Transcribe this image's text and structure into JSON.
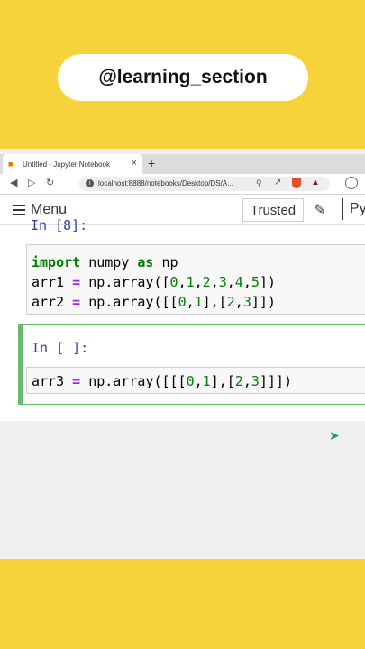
{
  "overlay": {
    "channel_handle": "@learning_section"
  },
  "browser": {
    "tab_title": "Untitled - Jupyter Notebook",
    "new_tab_label": "+",
    "url": "localhost:8888/notebooks/Desktop/DS/A..."
  },
  "notebook": {
    "menu_label": "Menu",
    "trusted_label": "Trusted",
    "kernel_label": "Py",
    "cells": [
      {
        "prompt": "In [8]:",
        "lines": [
          "import numpy as np",
          "arr1 = np.array([0,1,2,3,4,5])",
          "arr2 = np.array([[0,1],[2,3]])"
        ]
      },
      {
        "prompt": "In [ ]:",
        "lines": [
          "arr3 = np.array([[[0,1],[2,3]]])"
        ]
      }
    ]
  },
  "colors": {
    "background": "#f6d33a",
    "active_cell_border": "#66bb6a",
    "prompt_in": "#303f9f",
    "keyword": "#008000",
    "operator": "#aa22ff"
  }
}
